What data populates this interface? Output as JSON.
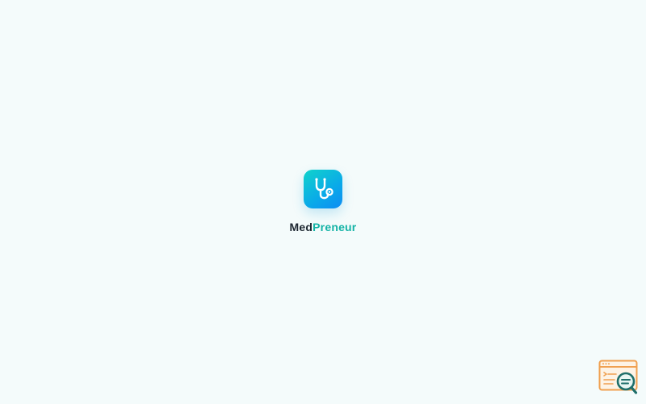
{
  "app": {
    "name_part_1": "Med",
    "name_part_2": "Preneur",
    "icon": "stethoscope-icon"
  },
  "colors": {
    "background": "#f4fbfb",
    "name_dark": "#1c2630",
    "name_accent": "#14b3a6",
    "icon_gradient_start": "#10d3cb",
    "icon_gradient_end": "#0f8cf3",
    "inspector_orange": "#f0a050",
    "inspector_teal": "#1f6f6a"
  },
  "overlay": {
    "inspector_icon": "browser-search-icon"
  }
}
